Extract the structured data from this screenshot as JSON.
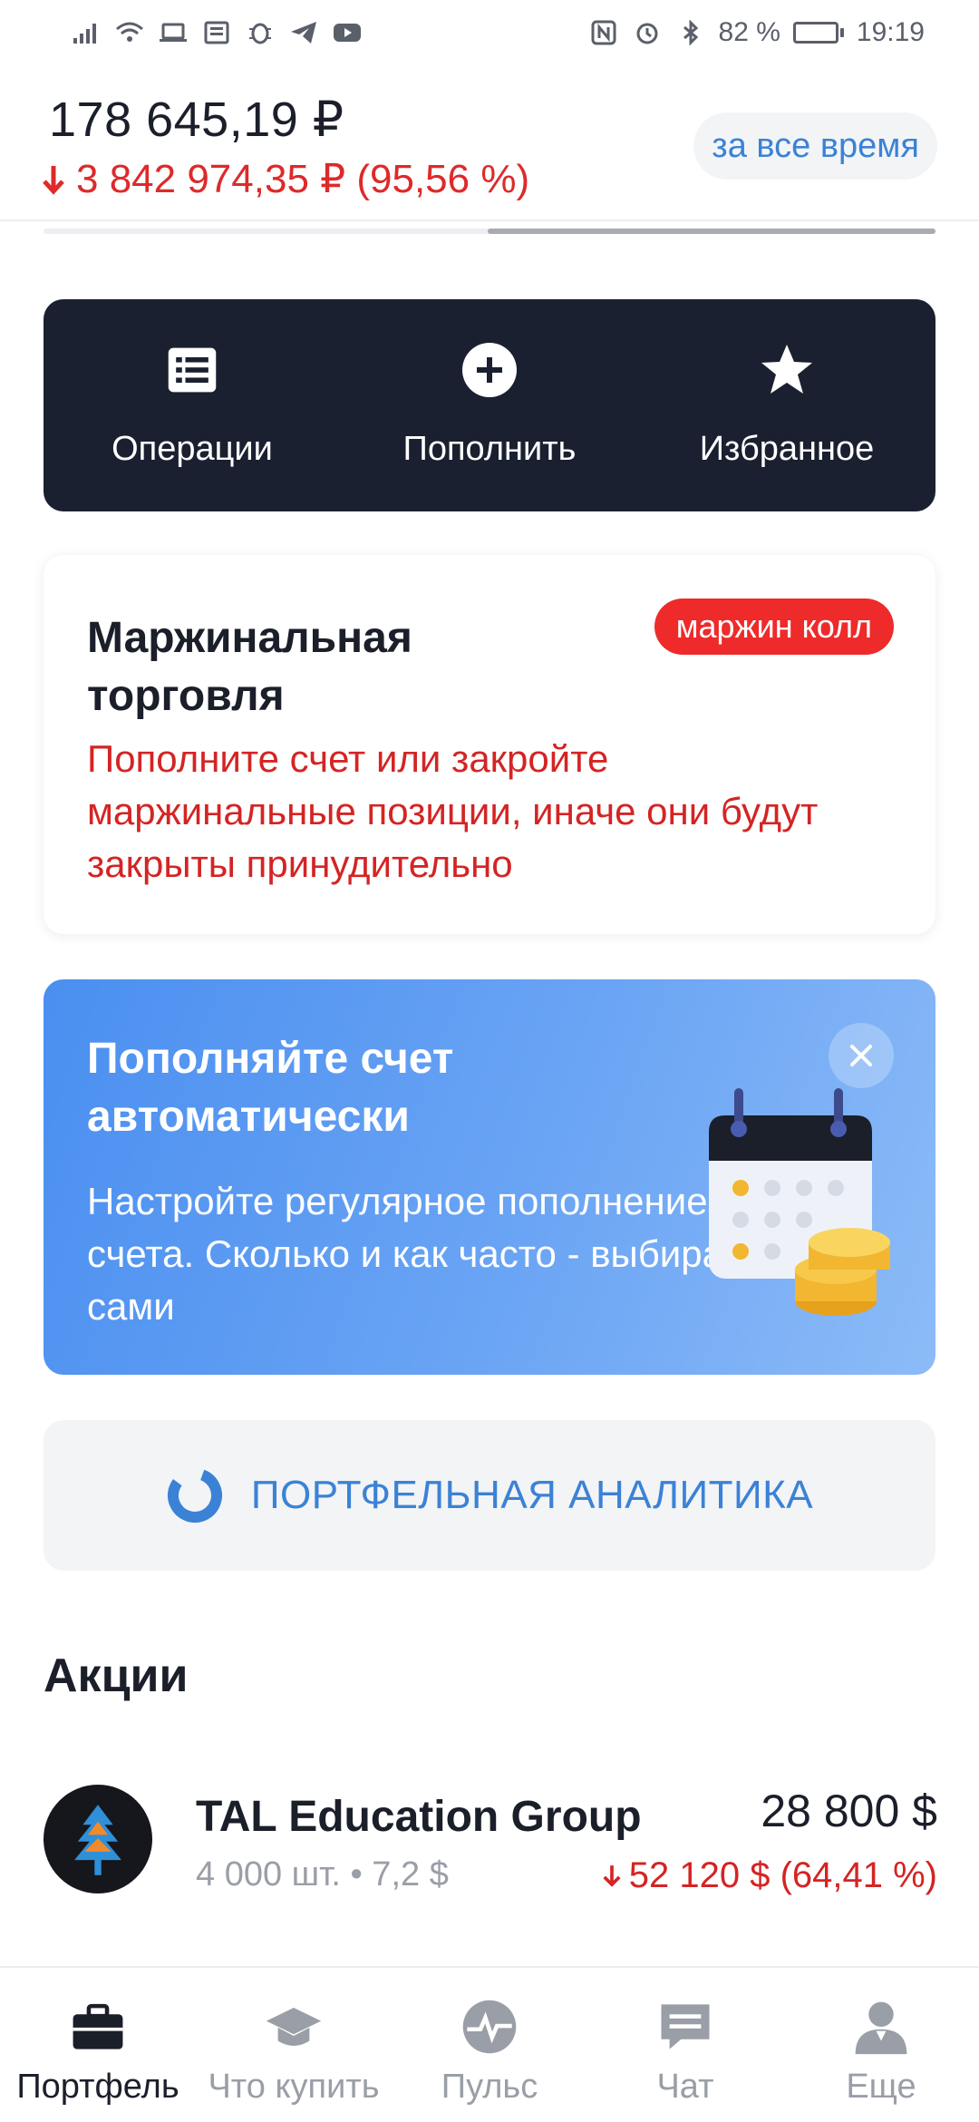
{
  "status_bar": {
    "battery": "82 %",
    "battery_level": 0.82,
    "time": "19:19",
    "left_icons": [
      "signal-icon",
      "wifi-icon",
      "laptop-icon",
      "news-icon",
      "bug-icon",
      "telegram-icon",
      "youtube-icon"
    ],
    "right_icons": [
      "nfc-icon",
      "alarm-icon",
      "bluetooth-icon"
    ]
  },
  "header": {
    "balance": "178 645,19 ₽",
    "change": "3 842 974,35 ₽ (95,56 %)",
    "period": "за все время"
  },
  "quick_actions": [
    {
      "label": "Операции",
      "icon": "list-icon"
    },
    {
      "label": "Пополнить",
      "icon": "plus-circle-icon"
    },
    {
      "label": "Избранное",
      "icon": "star-icon"
    }
  ],
  "margin_card": {
    "title": "Маржинальная торговля",
    "badge": "маржин колл",
    "text": "Пополните счет или закройте маржинальные позиции, иначе они будут закрыты принудительно"
  },
  "promo": {
    "title": "Пополняйте счет автоматически",
    "text": "Настройте регулярное пополнение счета. Сколько и как часто - выбираете сами"
  },
  "analytics": {
    "label": "ПОРТФЕЛЬНАЯ АНАЛИТИКА"
  },
  "stocks": {
    "title": "Акции",
    "items": [
      {
        "name": "TAL Education Group",
        "details": "4 000 шт. • 7,2 $",
        "value": "28 800 $",
        "change": "52 120 $ (64,41 %)"
      }
    ]
  },
  "bottom_nav": [
    {
      "label": "Портфель",
      "icon": "briefcase-icon",
      "active": true
    },
    {
      "label": "Что купить",
      "icon": "graduation-cap-icon",
      "active": false
    },
    {
      "label": "Пульс",
      "icon": "pulse-icon",
      "active": false
    },
    {
      "label": "Чат",
      "icon": "chat-icon",
      "active": false
    },
    {
      "label": "Еще",
      "icon": "profile-icon",
      "active": false
    }
  ],
  "colors": {
    "accent": "#3b82d6",
    "negative": "#d42424",
    "dark_panel": "#1a2030",
    "badge": "#ee2a2a"
  }
}
